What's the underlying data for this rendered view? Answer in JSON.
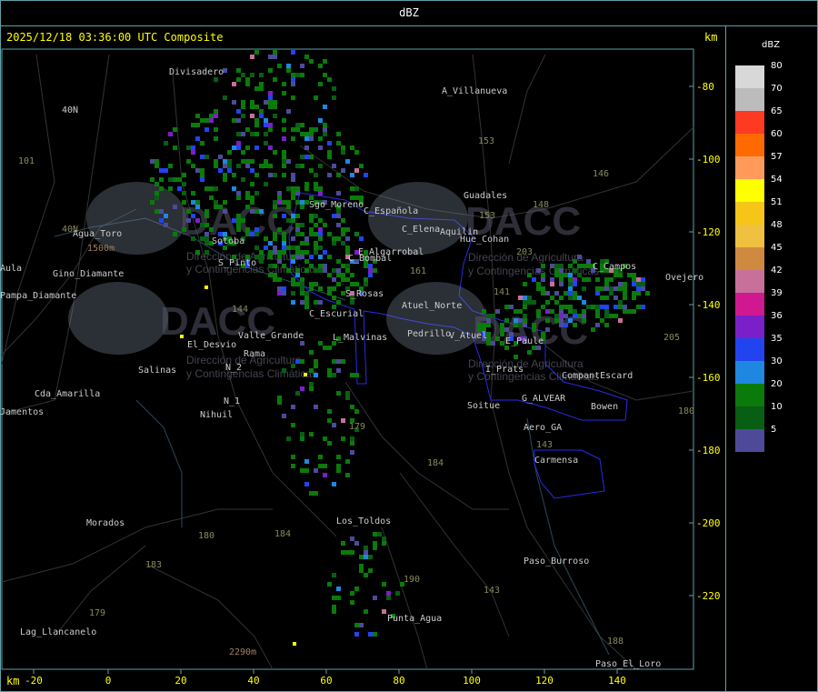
{
  "header": {
    "title": "dBZ"
  },
  "map": {
    "timestamp": "2025/12/18 03:36:00 UTC Composite",
    "unit_top": "km",
    "unit_bottom": "km",
    "x_ticks": [
      "-20",
      "0",
      "20",
      "40",
      "60",
      "80",
      "100",
      "120",
      "140"
    ],
    "y_ticks": [
      "-80",
      "-100",
      "-120",
      "-140",
      "-160",
      "-180",
      "-200",
      "-220"
    ],
    "places": [
      {
        "name": "Divisadero"
      },
      {
        "name": "A_Villanueva"
      },
      {
        "name": "C_Española"
      },
      {
        "name": "Sgo_Moreno"
      },
      {
        "name": "C_Elena"
      },
      {
        "name": "Aquilin"
      },
      {
        "name": "Hue_Cohan"
      },
      {
        "name": "Guadales"
      },
      {
        "name": "E_Algarrobal"
      },
      {
        "name": "C_Bombal"
      },
      {
        "name": "S_Pinto"
      },
      {
        "name": "Agua_Toro"
      },
      {
        "name": "Pampa_Diamante"
      },
      {
        "name": "Sotoba"
      },
      {
        "name": "S_Rosas"
      },
      {
        "name": "Atuel_Norte"
      },
      {
        "name": "C_Escurial"
      },
      {
        "name": "El_Desvio"
      },
      {
        "name": "Valle_Grande"
      },
      {
        "name": "L_Malvinas"
      },
      {
        "name": "V_Atuel"
      },
      {
        "name": "Salinas"
      },
      {
        "name": "I_Prats"
      },
      {
        "name": "CompantEscard"
      },
      {
        "name": "G_ALVEAR"
      },
      {
        "name": "Bowen"
      },
      {
        "name": "Soitue"
      },
      {
        "name": "Cda_Amarilla"
      },
      {
        "name": "N_1"
      },
      {
        "name": "Nihuil"
      },
      {
        "name": "N_2"
      },
      {
        "name": "Aero_GA"
      },
      {
        "name": "Carmensa"
      },
      {
        "name": "Morados"
      },
      {
        "name": "Los_Toldos"
      },
      {
        "name": "Paso_Burroso"
      },
      {
        "name": "Punta_Agua"
      },
      {
        "name": "Lag_Llancanelo"
      },
      {
        "name": "Paso_El_Loro"
      },
      {
        "name": "C_Campos"
      },
      {
        "name": "Ovejero"
      },
      {
        "name": "Pedrillo"
      },
      {
        "name": "40N"
      },
      {
        "name": "Aula"
      },
      {
        "name": "Jamentos"
      },
      {
        "name": "Gino_Diamante"
      },
      {
        "name": "Rama"
      },
      {
        "name": "E_Paule"
      }
    ],
    "route_labels": [
      "101",
      "40N",
      "153",
      "146",
      "148",
      "153",
      "203",
      "141",
      "144",
      "161",
      "179",
      "184",
      "180",
      "184",
      "183",
      "179",
      "190",
      "143",
      "143",
      "188",
      "205",
      "180"
    ],
    "elevation_labels": [
      "1500m",
      "2290m"
    ],
    "watermark": "DACC",
    "watermark_sub": [
      "Dirección de Agricultura",
      "y Contingencias Climáticas"
    ]
  },
  "legend": {
    "unit": "dBZ",
    "levels": [
      {
        "label": "80",
        "color": "#d8d8d8"
      },
      {
        "label": "70",
        "color": "#bcbcbc"
      },
      {
        "label": "65",
        "color": "#ff3a22"
      },
      {
        "label": "60",
        "color": "#ff6a00"
      },
      {
        "label": "57",
        "color": "#ff9a5a"
      },
      {
        "label": "54",
        "color": "#ffff00"
      },
      {
        "label": "51",
        "color": "#f5c518"
      },
      {
        "label": "48",
        "color": "#f0c040"
      },
      {
        "label": "45",
        "color": "#d08a40"
      },
      {
        "label": "42",
        "color": "#c8709a"
      },
      {
        "label": "39",
        "color": "#d01890"
      },
      {
        "label": "36",
        "color": "#7a20c8"
      },
      {
        "label": "35",
        "color": "#2244ee"
      },
      {
        "label": "30",
        "color": "#1e88e0"
      },
      {
        "label": "20",
        "color": "#0a7a0a"
      },
      {
        "label": "10",
        "color": "#085e12"
      },
      {
        "label": "5",
        "color": "#4e4a9a"
      }
    ]
  }
}
